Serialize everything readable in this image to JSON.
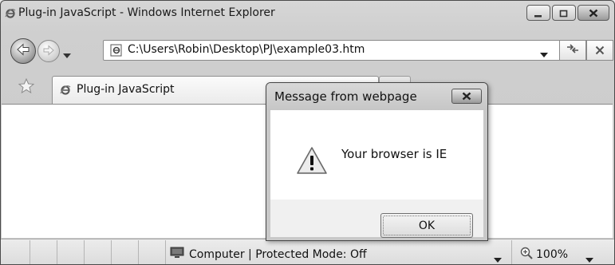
{
  "window": {
    "title": "Plug-in JavaScript - Windows Internet Explorer",
    "icon": "ie-icon",
    "controls": [
      "minimize-icon",
      "maximize-icon",
      "close-icon"
    ]
  },
  "navigation": {
    "back_icon": "back-arrow-icon",
    "forward_icon": "forward-arrow-icon",
    "address": "C:\\Users\\Robin\\Desktop\\PJ\\example03.htm",
    "refresh_icon": "refresh-icon",
    "stop_icon": "stop-icon"
  },
  "tabs": [
    {
      "label": "Plug-in JavaScript",
      "icon": "ie-icon",
      "active": true
    }
  ],
  "favorites_icon": "star-icon",
  "status_bar": {
    "zone_text": "Computer | Protected Mode: Off",
    "zoom": "100%"
  },
  "dialog": {
    "title": "Message from webpage",
    "message": "Your browser is IE",
    "ok_label": "OK",
    "icon": "warning-icon"
  }
}
